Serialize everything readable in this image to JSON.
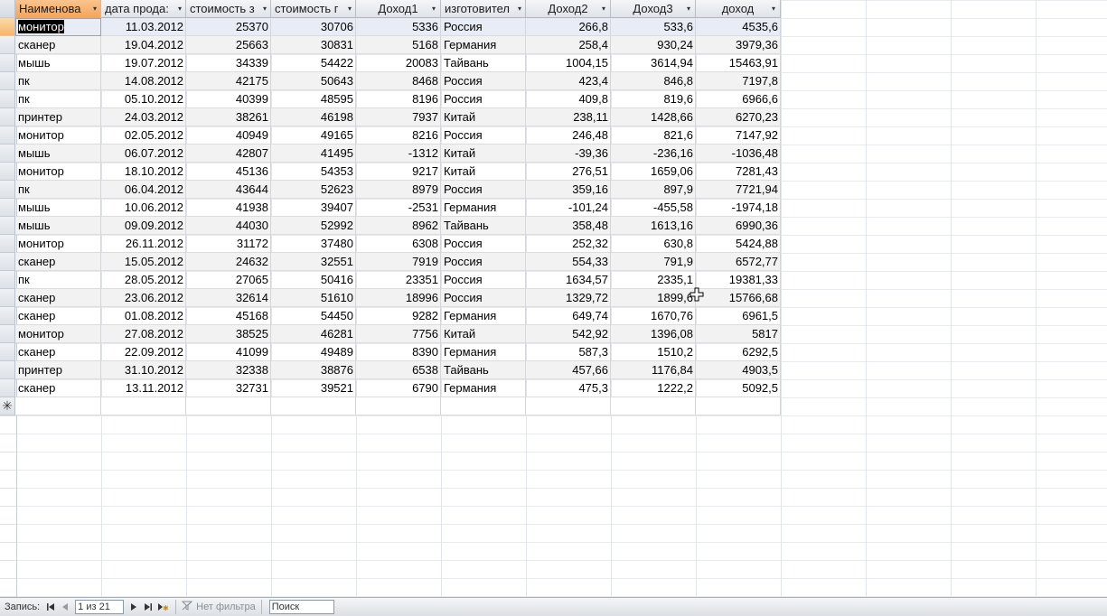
{
  "columns": [
    {
      "label": "Наименова",
      "align": "left"
    },
    {
      "label": "дата прода:",
      "align": "left"
    },
    {
      "label": "стоимость з",
      "align": "left"
    },
    {
      "label": "стоимость г",
      "align": "left"
    },
    {
      "label": "Доход1",
      "align": "center"
    },
    {
      "label": "изготовител",
      "align": "left"
    },
    {
      "label": "Доход2",
      "align": "center"
    },
    {
      "label": "Доход3",
      "align": "center"
    },
    {
      "label": "доход",
      "align": "center"
    }
  ],
  "rows": [
    [
      "монитор",
      "11.03.2012",
      "25370",
      "30706",
      "5336",
      "Россия",
      "266,8",
      "533,6",
      "4535,6"
    ],
    [
      "сканер",
      "19.04.2012",
      "25663",
      "30831",
      "5168",
      "Германия",
      "258,4",
      "930,24",
      "3979,36"
    ],
    [
      "мышь",
      "19.07.2012",
      "34339",
      "54422",
      "20083",
      "Тайвань",
      "1004,15",
      "3614,94",
      "15463,91"
    ],
    [
      "пк",
      "14.08.2012",
      "42175",
      "50643",
      "8468",
      "Россия",
      "423,4",
      "846,8",
      "7197,8"
    ],
    [
      "пк",
      "05.10.2012",
      "40399",
      "48595",
      "8196",
      "Россия",
      "409,8",
      "819,6",
      "6966,6"
    ],
    [
      "принтер",
      "24.03.2012",
      "38261",
      "46198",
      "7937",
      "Китай",
      "238,11",
      "1428,66",
      "6270,23"
    ],
    [
      "монитор",
      "02.05.2012",
      "40949",
      "49165",
      "8216",
      "Россия",
      "246,48",
      "821,6",
      "7147,92"
    ],
    [
      "мышь",
      "06.07.2012",
      "42807",
      "41495",
      "-1312",
      "Китай",
      "-39,36",
      "-236,16",
      "-1036,48"
    ],
    [
      "монитор",
      "18.10.2012",
      "45136",
      "54353",
      "9217",
      "Китай",
      "276,51",
      "1659,06",
      "7281,43"
    ],
    [
      "пк",
      "06.04.2012",
      "43644",
      "52623",
      "8979",
      "Россия",
      "359,16",
      "897,9",
      "7721,94"
    ],
    [
      "мышь",
      "10.06.2012",
      "41938",
      "39407",
      "-2531",
      "Германия",
      "-101,24",
      "-455,58",
      "-1974,18"
    ],
    [
      "мышь",
      "09.09.2012",
      "44030",
      "52992",
      "8962",
      "Тайвань",
      "358,48",
      "1613,16",
      "6990,36"
    ],
    [
      "монитор",
      "26.11.2012",
      "31172",
      "37480",
      "6308",
      "Россия",
      "252,32",
      "630,8",
      "5424,88"
    ],
    [
      "сканер",
      "15.05.2012",
      "24632",
      "32551",
      "7919",
      "Россия",
      "554,33",
      "791,9",
      "6572,77"
    ],
    [
      "пк",
      "28.05.2012",
      "27065",
      "50416",
      "23351",
      "Россия",
      "1634,57",
      "2335,1",
      "19381,33"
    ],
    [
      "сканер",
      "23.06.2012",
      "32614",
      "51610",
      "18996",
      "Россия",
      "1329,72",
      "1899,6",
      "15766,68"
    ],
    [
      "сканер",
      "01.08.2012",
      "45168",
      "54450",
      "9282",
      "Германия",
      "649,74",
      "1670,76",
      "6961,5"
    ],
    [
      "монитор",
      "27.08.2012",
      "38525",
      "46281",
      "7756",
      "Китай",
      "542,92",
      "1396,08",
      "5817"
    ],
    [
      "сканер",
      "22.09.2012",
      "41099",
      "49489",
      "8390",
      "Германия",
      "587,3",
      "1510,2",
      "6292,5"
    ],
    [
      "принтер",
      "31.10.2012",
      "32338",
      "38876",
      "6538",
      "Тайвань",
      "457,66",
      "1176,84",
      "4903,5"
    ],
    [
      "сканер",
      "13.11.2012",
      "32731",
      "39521",
      "6790",
      "Германия",
      "475,3",
      "1222,2",
      "5092,5"
    ]
  ],
  "new_row_marker": "✳",
  "statusbar": {
    "record_label": "Запись:",
    "record_position": "1 из 21",
    "filter_label": "Нет фильтра",
    "search_label": "Поиск"
  },
  "icons": {
    "first": "first-record-icon",
    "prev": "previous-record-icon",
    "next": "next-record-icon",
    "last": "last-record-icon",
    "new": "new-record-icon",
    "filter": "filter-icon",
    "cursor": "move-cursor-icon"
  },
  "colors": {
    "active_header": "#f5a55a",
    "alt_row": "#f2f2f2",
    "current_row": "#e7ecf5"
  }
}
